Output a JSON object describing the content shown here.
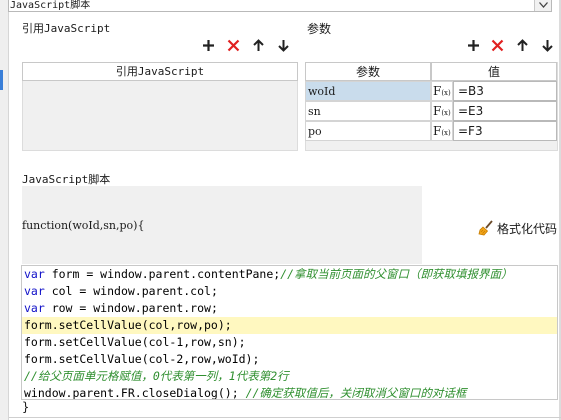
{
  "top_select": {
    "value": "JavaScript脚本"
  },
  "ref_section": {
    "title": "引用JavaScript",
    "column_header": "引用JavaScript"
  },
  "param_section": {
    "title": "参数",
    "columns": [
      "参数",
      "值"
    ],
    "rows": [
      {
        "name": "woId",
        "value": "=B3"
      },
      {
        "name": "sn",
        "value": "=E3"
      },
      {
        "name": "po",
        "value": "=F3"
      }
    ]
  },
  "toolbar": {
    "add_icon": "plus-icon",
    "delete_icon": "close-icon",
    "up_icon": "arrow-up-icon",
    "down_icon": "arrow-down-icon",
    "delete_color": "#e02020"
  },
  "fx_label": "F",
  "fx_sub": "(x)",
  "script_section": {
    "title": "JavaScript脚本",
    "signature": "function(woId,sn,po){",
    "format_button": "格式化代码",
    "closing": "}",
    "code_lines": [
      {
        "kw": "var",
        "text": " form = window.parent.contentPane;",
        "comment": "//拿取当前页面的父窗口（即获取填报界面）"
      },
      {
        "kw": "var",
        "text": " col = window.parent.col;",
        "comment": ""
      },
      {
        "kw": "var",
        "text": " row = window.parent.row;",
        "comment": ""
      },
      {
        "kw": "",
        "text": "form.setCellValue(col,row,po);",
        "comment": ""
      },
      {
        "kw": "",
        "text": "form.setCellValue(col-1,row,sn);",
        "comment": ""
      },
      {
        "kw": "",
        "text": "form.setCellValue(col-2,row,woId);",
        "comment": ""
      },
      {
        "kw": "",
        "text": "",
        "comment": "//给父页面单元格赋值，0代表第一列，1代表第2行"
      },
      {
        "kw": "",
        "text": "window.parent.FR.closeDialog(); ",
        "comment": "//确定获取值后，关闭取消父窗口的对话框"
      }
    ],
    "highlight_color": "#fff8c0"
  }
}
